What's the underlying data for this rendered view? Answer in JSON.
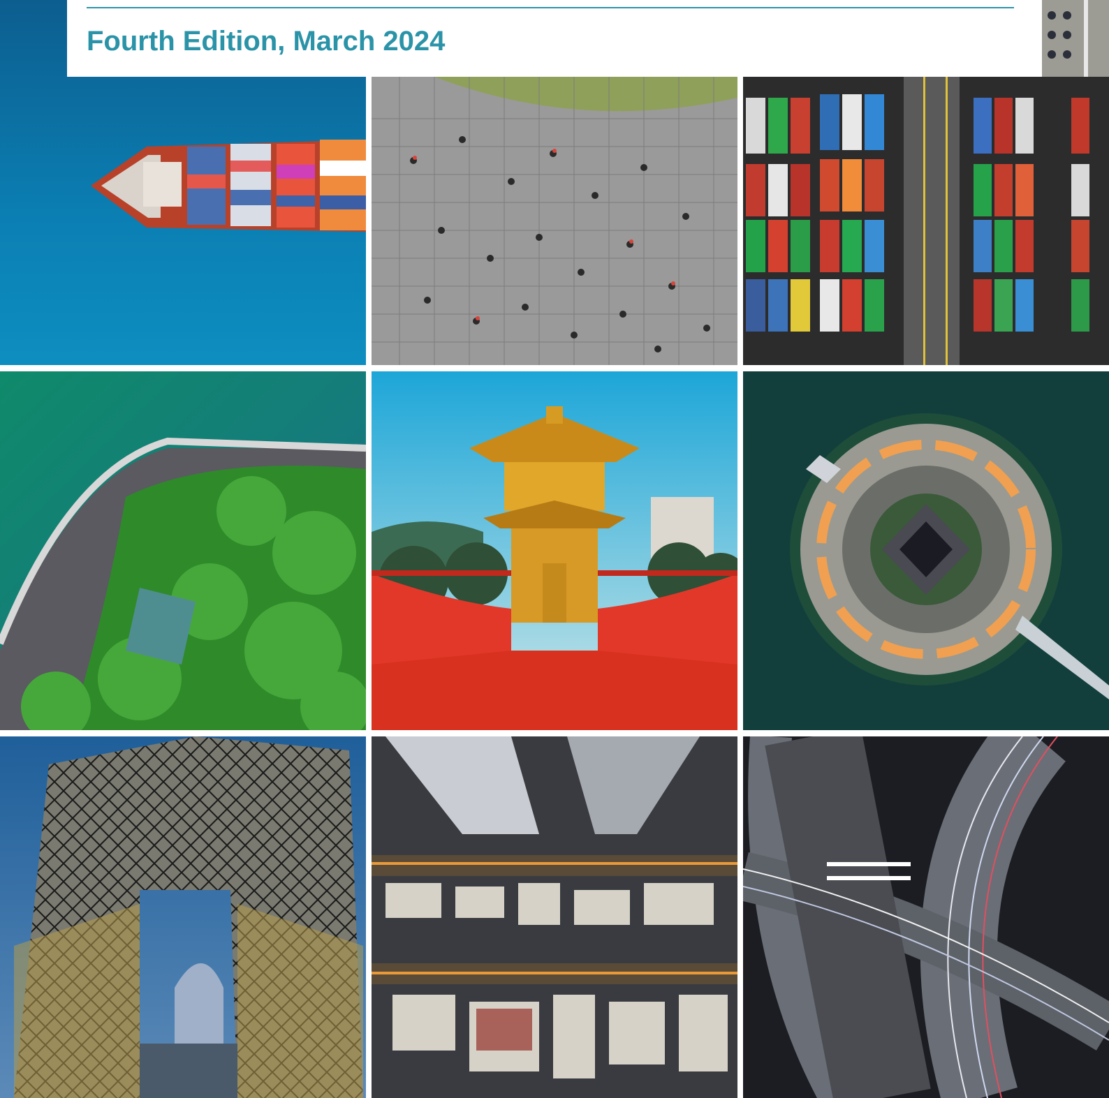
{
  "header": {
    "edition": "Fourth Edition, March 2024"
  },
  "colors": {
    "accent": "#2b93a8",
    "background": "#ffffff"
  },
  "photos": [
    {
      "id": "ship",
      "subject": "aerial view of container ship at sea"
    },
    {
      "id": "cyclists",
      "subject": "aerial view of cyclists on a paved plaza"
    },
    {
      "id": "containers",
      "subject": "aerial view of stacked shipping containers at a port"
    },
    {
      "id": "dam",
      "subject": "aerial view of a dam beside a green reservoir and forest"
    },
    {
      "id": "pavilion",
      "subject": "golden Chinese pavilion with red bridge"
    },
    {
      "id": "island",
      "subject": "aerial view of a circular temple island at night"
    },
    {
      "id": "cctv",
      "subject": "CCTV headquarters building at dusk"
    },
    {
      "id": "city",
      "subject": "top-down view of dense city streets"
    },
    {
      "id": "highway",
      "subject": "aerial view of highway interchange with light trails"
    }
  ]
}
